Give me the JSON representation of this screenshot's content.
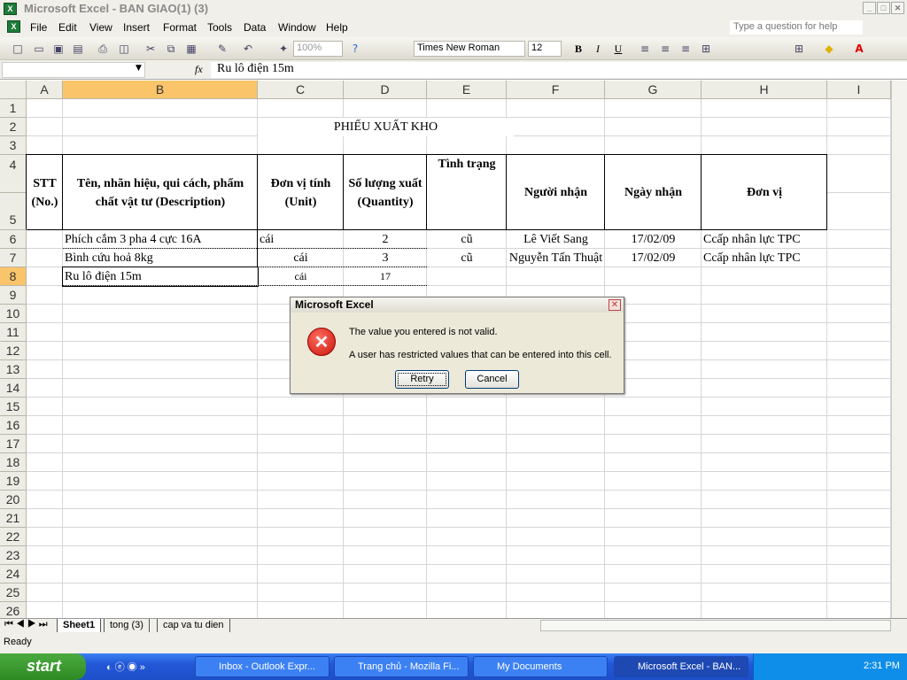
{
  "window": {
    "title": "Microsoft Excel - BAN GIAO(1) (3)"
  },
  "menu": {
    "items": [
      "File",
      "Edit",
      "View",
      "Insert",
      "Format",
      "Tools",
      "Data",
      "Window",
      "Help"
    ],
    "help_placeholder": "Type a question for help"
  },
  "toolbar": {
    "zoom": "100%",
    "font": "Times New Roman",
    "size": "12",
    "bold": "B",
    "italic": "I",
    "underline": "U"
  },
  "formula_bar": {
    "name_box": "",
    "fx": "fx",
    "value": "Ru lô điện 15m"
  },
  "columns": [
    "A",
    "B",
    "C",
    "D",
    "E",
    "F",
    "G",
    "H",
    "I"
  ],
  "selected_column": "B",
  "selected_row": 8,
  "rows": [
    "1",
    "2",
    "3",
    "4",
    "5",
    "6",
    "7",
    "8",
    "9",
    "10",
    "11",
    "12",
    "13",
    "14",
    "15",
    "16",
    "17",
    "18",
    "19",
    "20",
    "21",
    "22",
    "23",
    "24",
    "25",
    "26"
  ],
  "sheet": {
    "title": "PHIẾU XUẤT KHO",
    "headers": {
      "stt": "STT (No.)",
      "desc": "Tên, nhãn hiệu, qui cách, phẩm chất vật tư (Description)",
      "unit": "Đơn vị tính (Unit)",
      "qty": "Số lượng xuất (Quantity)",
      "status": "Tình trạng",
      "receiver": "Người nhận",
      "date": "Ngày nhận",
      "dept": "Đơn vị"
    },
    "data": [
      {
        "desc": "Phích cắm 3 pha 4 cực 16A",
        "unit": "cái",
        "qty": "2",
        "status": "cũ",
        "receiver": "Lê Viết Sang",
        "date": "17/02/09",
        "dept": "Ccấp nhân lực TPC"
      },
      {
        "desc": "Bình cứu hoả 8kg",
        "unit": "cái",
        "qty": "3",
        "status": "cũ",
        "receiver": "Nguyễn Tấn Thuật",
        "date": "17/02/09",
        "dept": "Ccấp nhân lực TPC"
      },
      {
        "desc": "Ru lô điện 15m",
        "unit": "cái",
        "qty": "17",
        "status": "",
        "receiver": "",
        "date": "",
        "dept": ""
      }
    ]
  },
  "tabs": [
    "Sheet1",
    "tong (3)",
    "cap va tu dien"
  ],
  "active_tab": "Sheet1",
  "status": "Ready",
  "dialog": {
    "title": "Microsoft Excel",
    "line1": "The value you entered is not valid.",
    "line2": "A user has restricted values that can be entered into this cell.",
    "retry": "Retry",
    "cancel": "Cancel",
    "close": "✕"
  },
  "taskbar": {
    "start": "start",
    "tasks": [
      "Inbox - Outlook Expr...",
      "Trang chủ - Mozilla Fi...",
      "My Documents",
      "Microsoft Excel - BAN..."
    ],
    "clock": "2:31 PM"
  }
}
